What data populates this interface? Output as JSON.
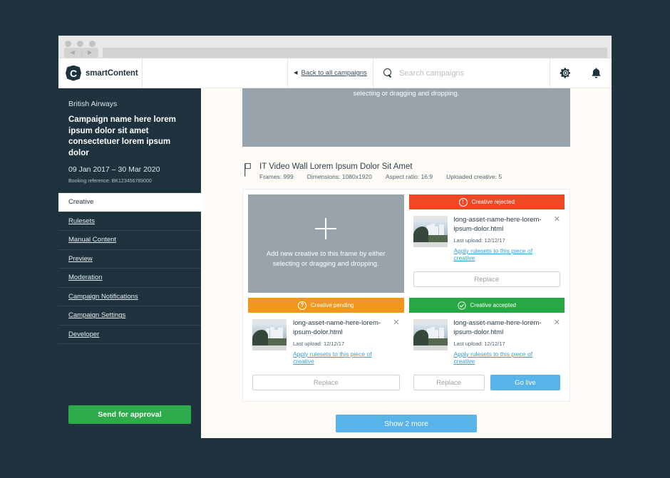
{
  "browser": {
    "back_glyph": "◀",
    "forward_glyph": "▶"
  },
  "header": {
    "brand_mark": "C",
    "brand_name": "smartContent",
    "back_caret": "◀",
    "back_link": "Back to all campaigns",
    "search_placeholder": "Search campaigns",
    "search_value": "",
    "search_icon": "search-icon",
    "settings_icon": "gear-icon",
    "notifications_icon": "bell-icon"
  },
  "sidebar": {
    "client": "British Airways",
    "campaign_title": "Campaign name here lorem ipsum dolor sit amet consectetuer lorem ipsum dolor",
    "dates": "09 Jan 2017 – 30 Mar 2020",
    "booking_reference": "Booking reference: BK123456789000",
    "items": [
      {
        "label": "Creative",
        "active": true
      },
      {
        "label": "Rulesets",
        "active": false
      },
      {
        "label": "Manual Content",
        "active": false
      },
      {
        "label": "Preview",
        "active": false
      },
      {
        "label": "Moderation",
        "active": false
      },
      {
        "label": "Campaign Notifications",
        "active": false
      },
      {
        "label": "Campaign Settings",
        "active": false
      },
      {
        "label": "Developer",
        "active": false
      }
    ],
    "send_approval_label": "Send for approval"
  },
  "main": {
    "dropzone_top_text": "selecting or dragging and dropping.",
    "frame": {
      "icon": "flag-icon",
      "title": "IT Video Wall Lorem Ipsum Dolor Sit Amet",
      "stats": [
        "Frames: 999",
        "Dimensions: 1080x1920",
        "Aspect ratio: 16:9",
        "Uploaded creative: 5"
      ]
    },
    "add_creative": {
      "icon": "plus-icon",
      "text": "Add new creative to this frame by either selecting or dragging and dropping."
    },
    "creatives": [
      {
        "status": "Creative rejected",
        "status_kind": "rejected",
        "status_icon": "exclamation-icon",
        "status_glyph": "!",
        "asset_name": "long-asset-name-here-lorem-ipsum-dolor.html",
        "last_upload": "Last upload: 12/12/17",
        "apply_link": "Apply rulesets to this piece of creative",
        "close_glyph": "✕",
        "replace_label": "Replace",
        "golive_label": null
      },
      {
        "status": "Creative pending",
        "status_kind": "pending",
        "status_icon": "question-icon",
        "status_glyph": "?",
        "asset_name": "long-asset-name-here-lorem-ipsum-dolor.html",
        "last_upload": "Last upload: 12/12/17",
        "apply_link": "Apply rulesets to this piece of creative",
        "close_glyph": "✕",
        "replace_label": "Replace",
        "golive_label": null
      },
      {
        "status": "Creative accepted",
        "status_kind": "accepted",
        "status_icon": "check-circle-icon",
        "status_glyph": "✓",
        "asset_name": "long-asset-name-here-lorem-ipsum-dolor.html",
        "last_upload": "Last upload: 12/12/17",
        "apply_link": "Apply rulesets to this piece of creative",
        "close_glyph": "✕",
        "replace_label": "Replace",
        "golive_label": "Go live"
      }
    ],
    "show_more_label": "Show 2 more"
  },
  "colors": {
    "dark": "#1e333d",
    "rejected": "#ef4823",
    "pending": "#f0971e",
    "accepted": "#27a844",
    "primary_blue": "#58b4e8",
    "green": "#2eab4a",
    "dropzone_grey": "#98a3ab",
    "page_bg": "#fffcf7"
  }
}
